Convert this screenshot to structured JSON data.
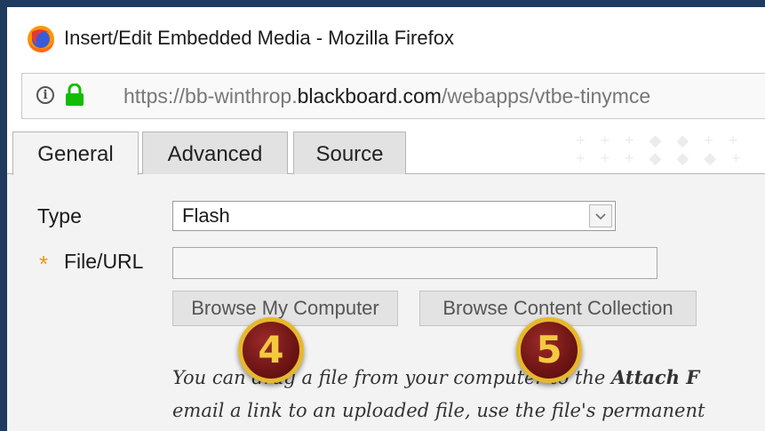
{
  "window": {
    "title": "Insert/Edit Embedded Media - Mozilla Firefox"
  },
  "address_bar": {
    "url_prefix": "https://bb-winthrop.",
    "url_domain": "blackboard.com",
    "url_path": "/webapps/vtbe-tinymce"
  },
  "tabs": [
    {
      "label": "General",
      "active": true
    },
    {
      "label": "Advanced",
      "active": false
    },
    {
      "label": "Source",
      "active": false
    }
  ],
  "form": {
    "type_label": "Type",
    "type_value": "Flash",
    "file_label": "File/URL",
    "file_value": "",
    "required_marker": "*"
  },
  "buttons": {
    "browse_computer": "Browse My Computer",
    "browse_collection": "Browse Content Collection"
  },
  "callouts": {
    "step4": "4",
    "step5": "5"
  },
  "help": {
    "line1_a": "You can drag a file from your computer to the ",
    "line1_b": "Attach F",
    "line2": "email a link to an uploaded file, use the file's permanent"
  },
  "colors": {
    "frame": "#1e3a5f",
    "required": "#e89a1a",
    "badge_fill": "#6e1414",
    "badge_ring": "#e6b82c"
  }
}
